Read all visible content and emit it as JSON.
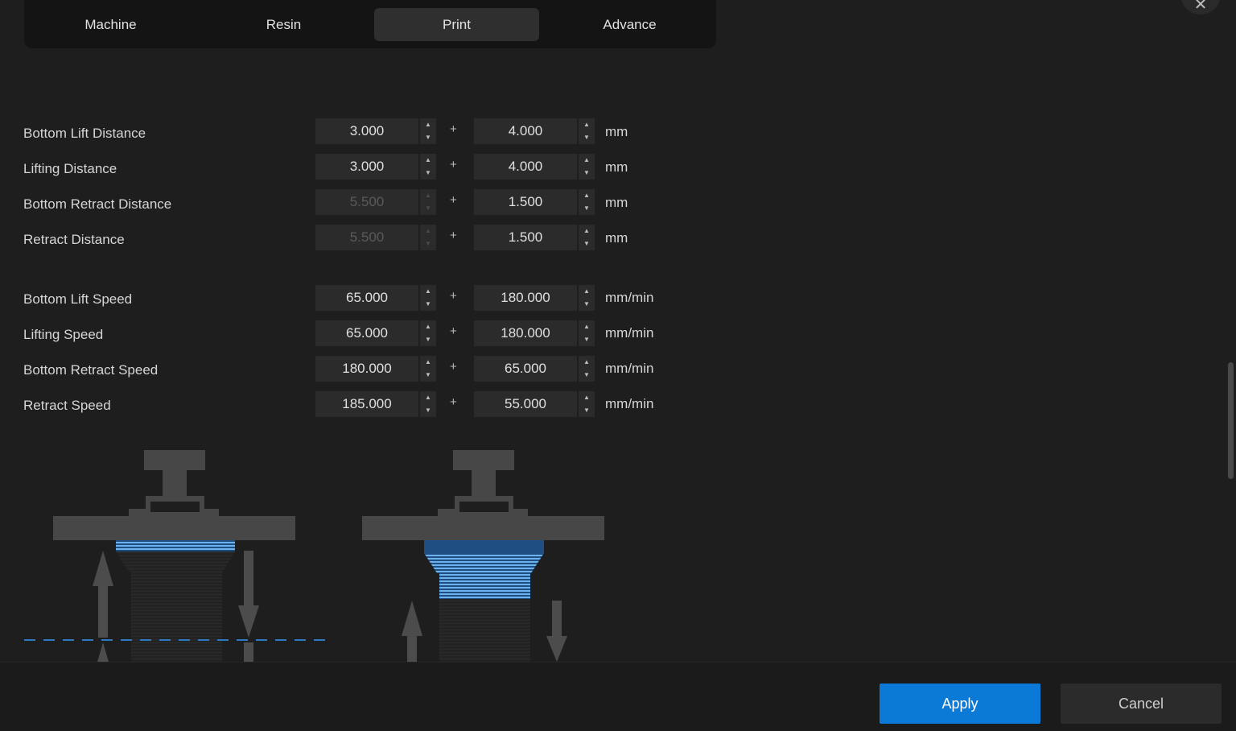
{
  "tabs": [
    {
      "label": "Machine"
    },
    {
      "label": "Resin"
    },
    {
      "label": "Print"
    },
    {
      "label": "Advance"
    }
  ],
  "active_tab": "Print",
  "plus_sign": "+",
  "rows": [
    {
      "label": "Bottom Lift Distance",
      "value1": "3.000",
      "value2": "4.000",
      "unit": "mm",
      "value1_enabled": true
    },
    {
      "label": "Lifting Distance",
      "value1": "3.000",
      "value2": "4.000",
      "unit": "mm",
      "value1_enabled": true
    },
    {
      "label": "Bottom Retract Distance",
      "value1": "5.500",
      "value2": "1.500",
      "unit": "mm",
      "value1_enabled": false
    },
    {
      "label": "Retract Distance",
      "value1": "5.500",
      "value2": "1.500",
      "unit": "mm",
      "value1_enabled": false
    },
    {
      "label": "Bottom Lift Speed",
      "value1": "65.000",
      "value2": "180.000",
      "unit": "mm/min",
      "value1_enabled": true
    },
    {
      "label": "Lifting Speed",
      "value1": "65.000",
      "value2": "180.000",
      "unit": "mm/min",
      "value1_enabled": true
    },
    {
      "label": "Bottom Retract Speed",
      "value1": "180.000",
      "value2": "65.000",
      "unit": "mm/min",
      "value1_enabled": true
    },
    {
      "label": "Retract Speed",
      "value1": "185.000",
      "value2": "55.000",
      "unit": "mm/min",
      "value1_enabled": true
    }
  ],
  "footer": {
    "apply_label": "Apply",
    "cancel_label": "Cancel"
  },
  "colors": {
    "accent": "#0b79d6",
    "layer_highlight": "#5aa8e8",
    "dash_line": "#2f78c4"
  },
  "icons": {
    "close": "close-icon",
    "step_up": "chevron-up-icon",
    "step_down": "chevron-down-icon"
  }
}
